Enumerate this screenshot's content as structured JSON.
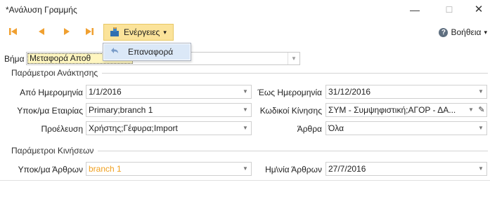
{
  "window": {
    "title": "*Ανάλυση Γραμμής",
    "minimize_glyph": "—",
    "maximize_glyph": "☐",
    "close_glyph": "✕"
  },
  "toolbar": {
    "actions_label": "Ενέργειες",
    "actions_caret": "▾",
    "help_label": "Βοήθεια",
    "help_caret": "▾",
    "help_glyph": "?"
  },
  "actions_menu": {
    "items": [
      {
        "label": "Επαναφορά",
        "icon": "undo-icon"
      }
    ]
  },
  "step": {
    "label": "Βήμα",
    "value": "Μεταφορά Αποθ"
  },
  "retrieval_params": {
    "title": "Παράμετροι Ανάκτησης",
    "from_date_label": "Από Ημερομηνία",
    "from_date_value": "1/1/2016",
    "to_date_label": "Έως Ημερομηνία",
    "to_date_value": "31/12/2016",
    "company_branch_label": "Υποκ/μα Εταιρίας",
    "company_branch_value": "Primary;branch 1",
    "movement_codes_label": "Κωδικοί Κίνησης",
    "movement_codes_value": "ΣΥΜ - Συμψηφιστική;ΑΓΟΡ - ΔΑ...",
    "origin_label": "Προέλευση",
    "origin_value": "Χρήστης;Γέφυρα;Import",
    "articles_label": "Άρθρα",
    "articles_value": "Όλα"
  },
  "movement_params": {
    "title": "Παράμετροι Κινήσεων",
    "article_branch_label": "Υποκ/μα Άρθρων",
    "article_branch_value": "branch 1",
    "article_date_label": "Ημ\\νία Άρθρων",
    "article_date_value": "27/7/2016"
  },
  "colors": {
    "actions_button_bg": "#fbe39a",
    "nav_arrow": "#f0a030",
    "menu_highlight": "#dbe8f7",
    "orange_value": "#f0a020"
  },
  "dropdown_arrow": "▼",
  "pencil_glyph": "✎"
}
